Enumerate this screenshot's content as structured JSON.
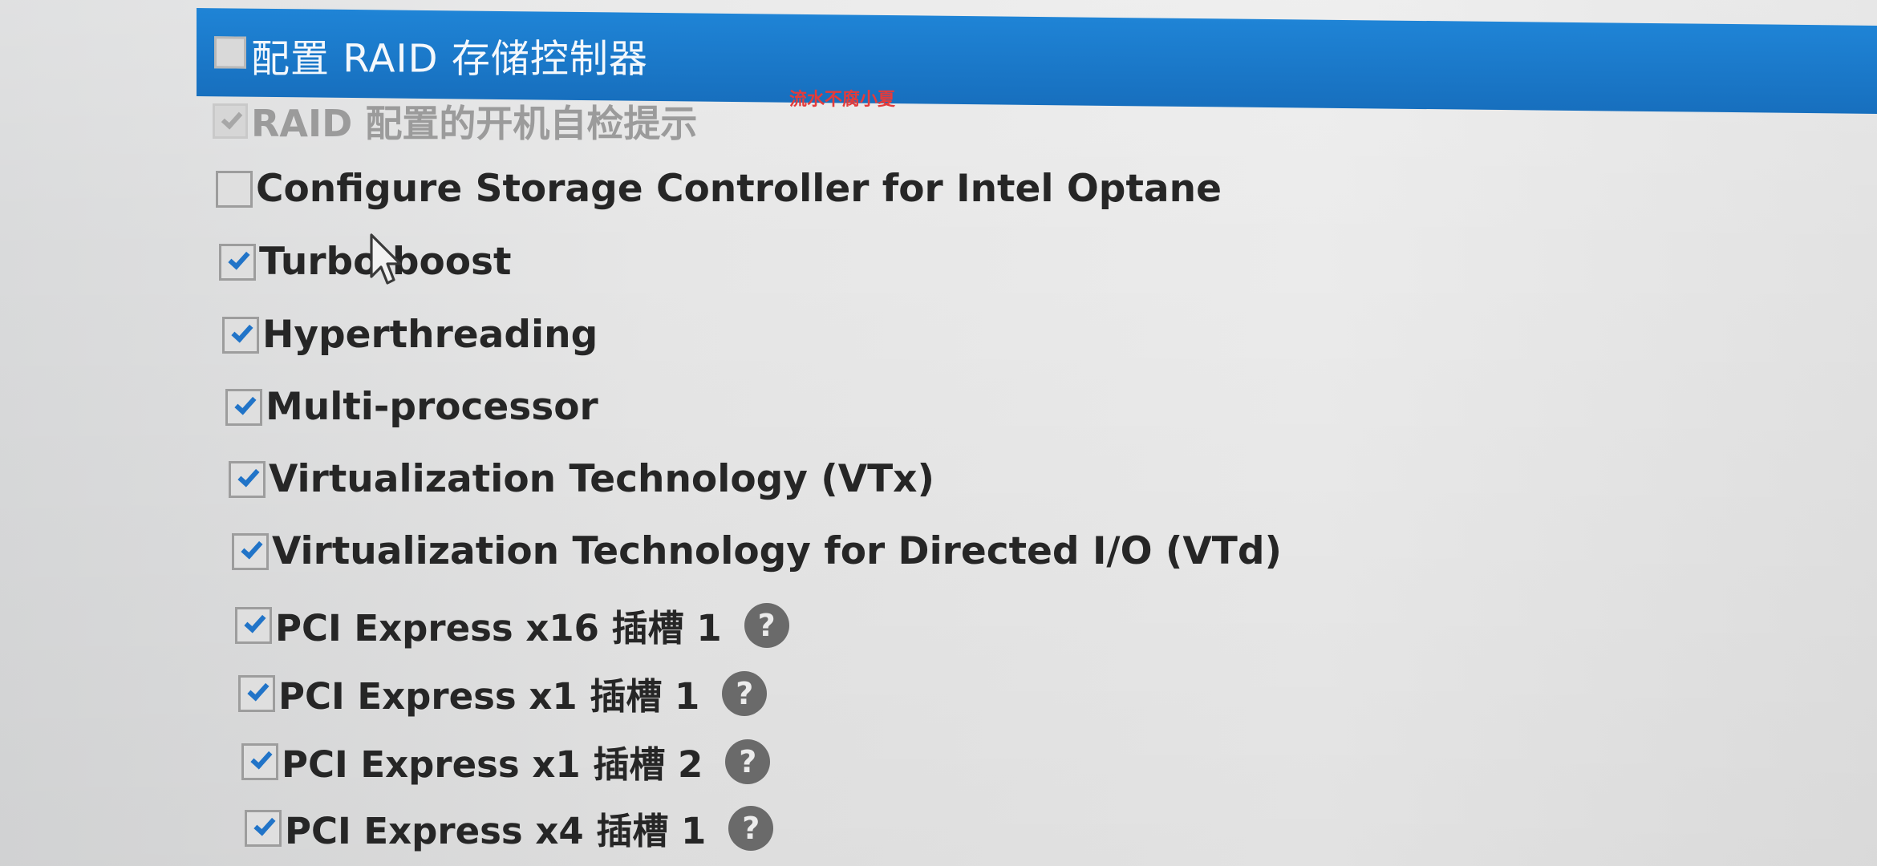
{
  "header": {
    "title": "配置 RAID 存储控制器",
    "checked": false
  },
  "watermark": "流水不腐小夏",
  "options": [
    {
      "label": "RAID 配置的开机自检提示",
      "checked": true,
      "disabled": true,
      "help": false
    },
    {
      "label": "Configure Storage Controller for Intel Optane",
      "checked": false,
      "disabled": false,
      "help": false
    },
    {
      "label": "Turbo boost",
      "checked": true,
      "disabled": false,
      "help": false
    },
    {
      "label": "Hyperthreading",
      "checked": true,
      "disabled": false,
      "help": false
    },
    {
      "label": "Multi-processor",
      "checked": true,
      "disabled": false,
      "help": false
    },
    {
      "label": "Virtualization Technology (VTx)",
      "checked": true,
      "disabled": false,
      "help": false
    },
    {
      "label": "Virtualization Technology for Directed I/O (VTd)",
      "checked": true,
      "disabled": false,
      "help": false
    },
    {
      "label": "PCI Express x16 插槽 1",
      "checked": true,
      "disabled": false,
      "help": true
    },
    {
      "label": "PCI Express x1 插槽 1",
      "checked": true,
      "disabled": false,
      "help": true
    },
    {
      "label": "PCI Express x1 插槽 2",
      "checked": true,
      "disabled": false,
      "help": true
    },
    {
      "label": "PCI Express x4 插槽 1",
      "checked": true,
      "disabled": false,
      "help": true
    }
  ],
  "help_icon_glyph": "?",
  "colors": {
    "header_blue": "#1b7acb",
    "check_blue": "#2174c8",
    "watermark_red": "#e43b3b"
  },
  "icons": {
    "checkbox": "checkbox-icon",
    "checkmark": "checkmark-icon",
    "help": "question-circle-icon",
    "cursor": "mouse-pointer-icon"
  }
}
